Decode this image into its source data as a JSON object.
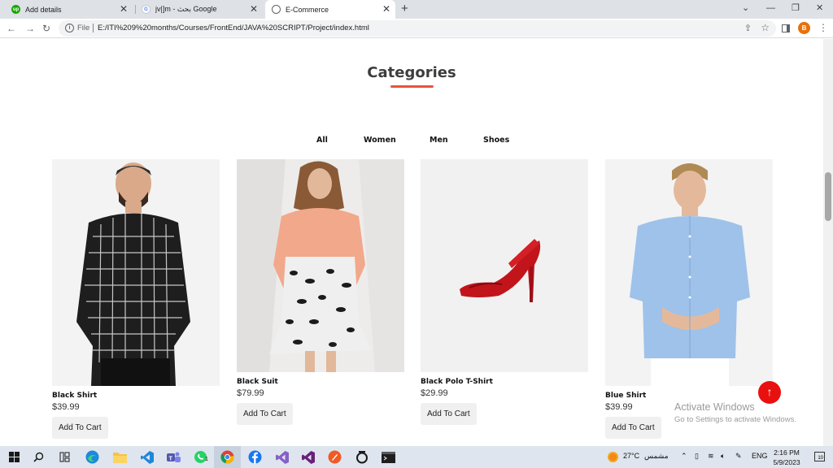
{
  "browser": {
    "tabs": [
      {
        "title": "Add details",
        "close": "✕"
      },
      {
        "title": "jv|]m - بحث Google",
        "close": "✕"
      },
      {
        "title": "E-Commerce",
        "close": "✕"
      }
    ],
    "new_tab": "+",
    "address": {
      "scheme_label": "File",
      "url": "E:/ITI%209%20months/Courses/FrontEnd/JAVA%20SCRIPT/Project/index.html"
    },
    "profile_initial": "B"
  },
  "page": {
    "section_title": "Categories",
    "accent_color": "#e8533e",
    "filters": [
      "All",
      "Women",
      "Men",
      "Shoes"
    ],
    "products": [
      {
        "name": "Black Shirt",
        "price": "$39.99",
        "button": "Add To Cart"
      },
      {
        "name": "Black Suit",
        "price": "$79.99",
        "button": "Add To Cart"
      },
      {
        "name": "Black Polo T-Shirt",
        "price": "$29.99",
        "button": "Add To Cart"
      },
      {
        "name": "Blue Shirt",
        "price": "$39.99",
        "button": "Add To Cart"
      }
    ],
    "scroll_top_icon": "↑"
  },
  "watermark": {
    "line1": "Activate Windows",
    "line2": "Go to Settings to activate Windows."
  },
  "taskbar": {
    "weather_temp": "27°C",
    "weather_text": "مشمس",
    "language": "ENG",
    "time": "2:16 PM",
    "date": "5/9/2023",
    "notification_count": "10",
    "whatsapp_badge": "1"
  }
}
